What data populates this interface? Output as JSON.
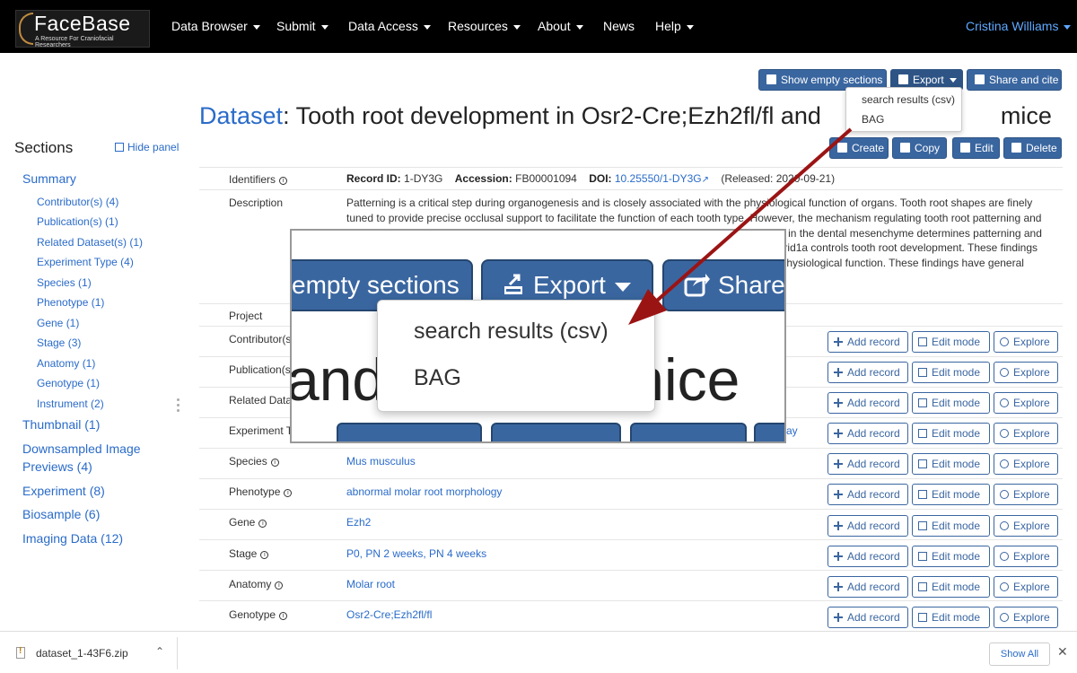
{
  "nav": {
    "logo_title": "FaceBase",
    "logo_subtitle": "A Resource For Craniofacial Researchers",
    "items": [
      "Data Browser",
      "Submit",
      "Data Access",
      "Resources",
      "About",
      "News",
      "Help"
    ],
    "user": "Cristina Williams"
  },
  "toolbar": {
    "show_empty": "Show empty sections",
    "export": "Export",
    "share": "Share and cite",
    "create": "Create",
    "copy": "Copy",
    "edit": "Edit",
    "delete": "Delete"
  },
  "export_menu": [
    "search results (csv)",
    "BAG"
  ],
  "title": {
    "prefix": "Dataset",
    "text": ": Tooth root development in Osr2-Cre;Ezh2fl/fl and",
    "suffix": "mice"
  },
  "sidebar": {
    "heading": "Sections",
    "hide_panel": "Hide panel",
    "summary": "Summary",
    "sub_items": [
      "Contributor(s) (4)",
      "Publication(s) (1)",
      "Related Dataset(s) (1)",
      "Experiment Type (4)",
      "Species (1)",
      "Phenotype (1)",
      "Gene (1)",
      "Stage (3)",
      "Anatomy (1)",
      "Genotype (1)",
      "Instrument (2)"
    ],
    "top_items": [
      "Thumbnail (1)",
      "Downsampled Image",
      "Previews (4)",
      "Experiment (8)",
      "Biosample (6)",
      "Imaging Data (12)"
    ]
  },
  "record": {
    "identifiers_label": "Identifiers",
    "record_id_label": "Record ID:",
    "record_id": "1-DY3G",
    "accession_label": "Accession:",
    "accession": "FB00001094",
    "doi_label": "DOI:",
    "doi": "10.25550/1-DY3G",
    "released": "(Released: 2020-09-21)",
    "description_label": "Description",
    "description": "Patterning is a critical step during organogenesis and is closely associated with the physiological function of organs. Tooth root shapes are finely tuned to provide precise occlusal support to facilitate the function of each tooth type. However, the mechanism regulating tooth root patterning and development is largely unknown. In this study, we examined the role of epigenetic regulation in the dental mesenchyme determines patterning and furcation formation. We found that the interaction between epigenetic regulators Ezh2 and Arid1a controls tooth root development. These findings indicate the importance of epigenetic regulation coordinating with the jaw bones to achieve physiological function. These findings have general implications for tooth regeneration in the future.",
    "project_label": "Project",
    "rows": [
      {
        "label": "Contributor(s)",
        "value": ""
      },
      {
        "label": "Publication(s)",
        "value": ""
      },
      {
        "label": "Related Datasets",
        "value": ""
      },
      {
        "label": "Experiment Ty",
        "value": "ay"
      },
      {
        "label": "Species",
        "value": "Mus musculus"
      },
      {
        "label": "Phenotype",
        "value": "abnormal molar root morphology"
      },
      {
        "label": "Gene",
        "value": "Ezh2"
      },
      {
        "label": "Stage",
        "value": "P0, PN 2 weeks, PN 4 weeks"
      },
      {
        "label": "Anatomy",
        "value": "Molar root"
      },
      {
        "label": "Genotype",
        "value": "Osr2-Cre;Ezh2fl/fl"
      }
    ],
    "btn_add": "Add record",
    "btn_edit": "Edit mode",
    "btn_explore": "Explore"
  },
  "zoom": {
    "btn_left": "empty sections",
    "btn_export": "Export",
    "btn_share": "Share",
    "title_left": "and",
    "title_right": "mice",
    "menu": [
      "search results (csv)",
      "BAG"
    ]
  },
  "downloads": {
    "file": "dataset_1-43F6.zip",
    "show_all": "Show All"
  },
  "colors": {
    "accent": "#3a66a0",
    "link": "#2a6bc9",
    "arrow": "#9b1414"
  }
}
